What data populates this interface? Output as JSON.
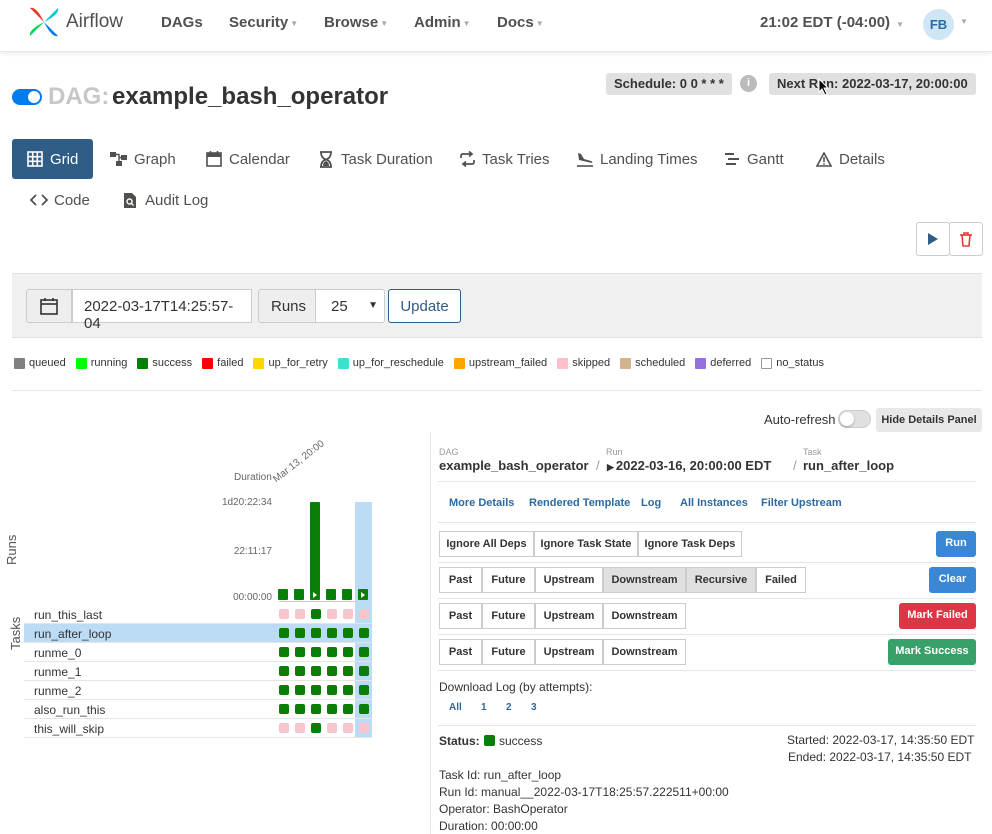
{
  "nav": {
    "brand": "Airflow",
    "items": [
      "DAGs",
      "Security",
      "Browse",
      "Admin",
      "Docs"
    ],
    "clock": "21:02 EDT (-04:00)",
    "user_initials": "FB"
  },
  "dag": {
    "prefix": "DAG:",
    "name": "example_bash_operator",
    "schedule": "Schedule: 0 0 * * *",
    "next_run": "Next Run: 2022-03-17, 20:00:00",
    "info": "i"
  },
  "tabs": [
    "Grid",
    "Graph",
    "Calendar",
    "Task Duration",
    "Task Tries",
    "Landing Times",
    "Gantt",
    "Details",
    "Code",
    "Audit Log"
  ],
  "filter": {
    "date": "2022-03-17T14:25:57-04",
    "runs_label": "Runs",
    "runs_value": "25",
    "update_label": "Update"
  },
  "legend": [
    {
      "label": "queued",
      "color": "#808080"
    },
    {
      "label": "running",
      "color": "#00ff00"
    },
    {
      "label": "success",
      "color": "#008000"
    },
    {
      "label": "failed",
      "color": "#ff0000"
    },
    {
      "label": "up_for_retry",
      "color": "#ffd700"
    },
    {
      "label": "up_for_reschedule",
      "color": "#40e0d0"
    },
    {
      "label": "upstream_failed",
      "color": "#ffa500"
    },
    {
      "label": "skipped",
      "color": "#ffc0cb"
    },
    {
      "label": "scheduled",
      "color": "#d2b48c"
    },
    {
      "label": "deferred",
      "color": "#9370db"
    },
    {
      "label": "no_status",
      "color": "#ffffff"
    }
  ],
  "autorefresh": {
    "label": "Auto-refresh",
    "hide_panel": "Hide Details Panel"
  },
  "grid": {
    "duration_label": "Duration",
    "date_label": "Mar 13, 20:00",
    "y_ticks": [
      "1d20:22:34",
      "22:11:17",
      "00:00:00"
    ],
    "runs_label": "Runs",
    "tasks_label": "Tasks",
    "run_durations": [
      0,
      0,
      1,
      0,
      0,
      0
    ],
    "tasks": [
      {
        "name": "run_this_last",
        "states": [
          "k",
          "k",
          "s",
          "k",
          "k",
          "k"
        ]
      },
      {
        "name": "run_after_loop",
        "states": [
          "s",
          "s",
          "s",
          "s",
          "s",
          "s"
        ]
      },
      {
        "name": "runme_0",
        "states": [
          "s",
          "s",
          "s",
          "s",
          "s",
          "s"
        ]
      },
      {
        "name": "runme_1",
        "states": [
          "s",
          "s",
          "s",
          "s",
          "s",
          "s"
        ]
      },
      {
        "name": "runme_2",
        "states": [
          "s",
          "s",
          "s",
          "s",
          "s",
          "s"
        ]
      },
      {
        "name": "also_run_this",
        "states": [
          "s",
          "s",
          "s",
          "s",
          "s",
          "s"
        ]
      },
      {
        "name": "this_will_skip",
        "states": [
          "k",
          "k",
          "s",
          "k",
          "k",
          "k"
        ]
      }
    ]
  },
  "details": {
    "bc": {
      "dag_label": "DAG",
      "dag": "example_bash_operator",
      "run_label": "Run",
      "run": "2022-03-16, 20:00:00 EDT",
      "task_label": "Task",
      "task": "run_after_loop"
    },
    "links": [
      "More Details",
      "Rendered Template",
      "Log",
      "All Instances",
      "Filter Upstream"
    ],
    "row1": [
      "Ignore All Deps",
      "Ignore Task State",
      "Ignore Task Deps"
    ],
    "run_btn": "Run",
    "row2": [
      "Past",
      "Future",
      "Upstream",
      "Downstream",
      "Recursive",
      "Failed"
    ],
    "clear_btn": "Clear",
    "row3": [
      "Past",
      "Future",
      "Upstream",
      "Downstream"
    ],
    "mark_failed_btn": "Mark Failed",
    "row4": [
      "Past",
      "Future",
      "Upstream",
      "Downstream"
    ],
    "mark_success_btn": "Mark Success",
    "download_title": "Download Log (by attempts):",
    "download_links": [
      "All",
      "1",
      "2",
      "3"
    ],
    "status_label": "Status:",
    "status_value": "success",
    "started": "Started: 2022-03-17, 14:35:50 EDT",
    "ended": "Ended: 2022-03-17, 14:35:50 EDT",
    "task_id": "Task Id: run_after_loop",
    "run_id": "Run Id: manual__2022-03-17T18:25:57.222511+00:00",
    "operator": "Operator: BashOperator",
    "duration": "Duration: 00:00:00"
  }
}
